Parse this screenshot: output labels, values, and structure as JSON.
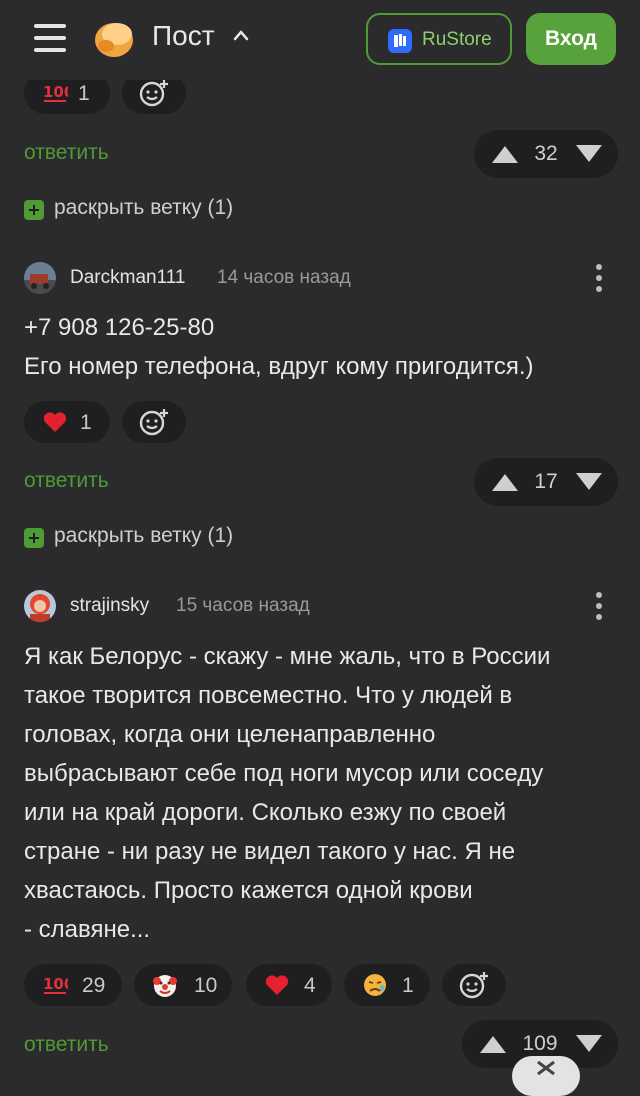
{
  "header": {
    "title": "Пост",
    "rustore_label": "RuStore",
    "login_label": "Вход"
  },
  "icons": {
    "menu": "hamburger-menu-icon",
    "logo": "pikabu-logo-icon",
    "chevron": "chevron-up-icon",
    "rustore": "rustore-icon",
    "add_reaction": "add-reaction-icon",
    "upvote": "upvote-triangle-icon",
    "downvote": "downvote-triangle-icon",
    "more": "more-vertical-icon",
    "expand": "plus-square-icon"
  },
  "colors": {
    "background": "#2b2b2d",
    "accent_green": "#4f9b34",
    "button_green": "#58a23c",
    "chip_bg": "#1f1f21"
  },
  "top_comment": {
    "reactions": [
      {
        "emoji": "hundred-points",
        "count": "1"
      }
    ],
    "reply_label": "ответить",
    "rating": "32",
    "expand_label": "раскрыть ветку (1)"
  },
  "comments": [
    {
      "author": "Darckman111",
      "time": "14 часов назад",
      "text_lines": [
        "+7 908 126-25-80",
        "Его номер телефона, вдруг кому пригодится.)"
      ],
      "reactions": [
        {
          "emoji": "heart",
          "count": "1"
        }
      ],
      "reply_label": "ответить",
      "rating": "17",
      "expand_label": "раскрыть ветку (1)"
    },
    {
      "author": "strajinsky",
      "time": "15 часов назад",
      "text_lines": [
        "Я как Белорус - скажу - мне жаль, что в России",
        "такое творится повсеместно. Что у людей в",
        "головах, когда они целенаправленно",
        "выбрасывают себе под ноги мусор или соседу",
        "или на край дороги. Сколько езжу по своей",
        "стране - ни разу не видел такого у нас. Я не",
        "хвастаюсь. Просто кажется одной крови",
        "- славяне..."
      ],
      "reactions": [
        {
          "emoji": "hundred-points",
          "count": "29"
        },
        {
          "emoji": "clown-face",
          "count": "10"
        },
        {
          "emoji": "heart",
          "count": "4"
        },
        {
          "emoji": "sad-face",
          "count": "1"
        }
      ],
      "reply_label": "ответить",
      "rating": "109"
    }
  ]
}
